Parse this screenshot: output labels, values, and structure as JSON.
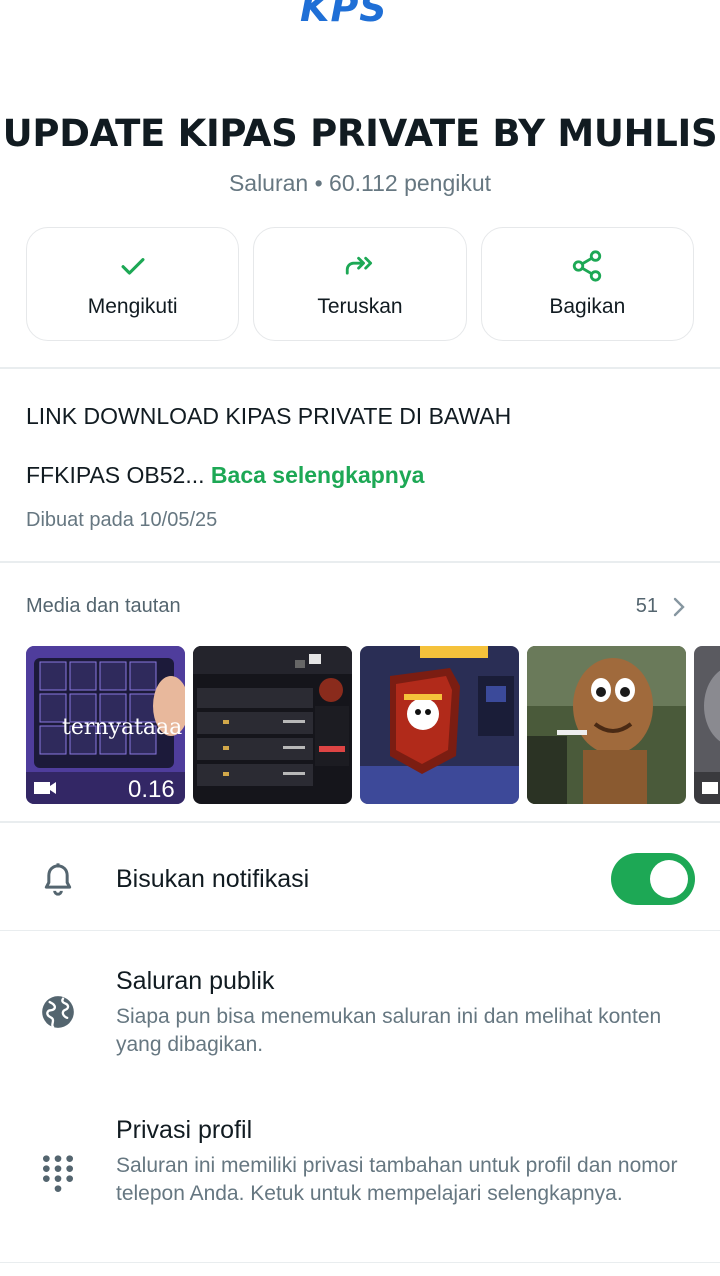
{
  "logo": {
    "text": "KPS"
  },
  "channel": {
    "name": "UPDATE KIPAS PRIVATE BY MUHLIS",
    "subtitle": "Saluran • 60.112 pengikut"
  },
  "actions": [
    {
      "label": "Mengikuti",
      "icon": "check-icon"
    },
    {
      "label": "Teruskan",
      "icon": "forward-icon"
    },
    {
      "label": "Bagikan",
      "icon": "share-icon"
    }
  ],
  "description": {
    "line1": "LINK DOWNLOAD KIPAS PRIVATE DI BAWAH",
    "line2": "FFKIPAS OB52...",
    "read_more": "Baca selengkapnya",
    "created": "Dibuat pada 10/05/25"
  },
  "media": {
    "title": "Media dan tautan",
    "count": "51",
    "items": [
      {
        "type": "video",
        "caption": "ternyataaa",
        "duration": "0.16"
      },
      {
        "type": "image"
      },
      {
        "type": "image"
      },
      {
        "type": "image"
      },
      {
        "type": "video"
      }
    ]
  },
  "settings": {
    "mute": {
      "label": "Bisukan notifikasi",
      "enabled": true
    },
    "public": {
      "title": "Saluran publik",
      "subtitle": "Siapa pun bisa menemukan saluran ini dan melihat konten yang dibagikan."
    },
    "privacy": {
      "title": "Privasi profil",
      "subtitle": "Saluran ini memiliki privasi tambahan untuk profil dan nomor telepon Anda. Ketuk untuk mempelajari selengkapnya."
    }
  },
  "colors": {
    "accent": "#1da855",
    "text": "#111b21",
    "secondary": "#667781"
  }
}
